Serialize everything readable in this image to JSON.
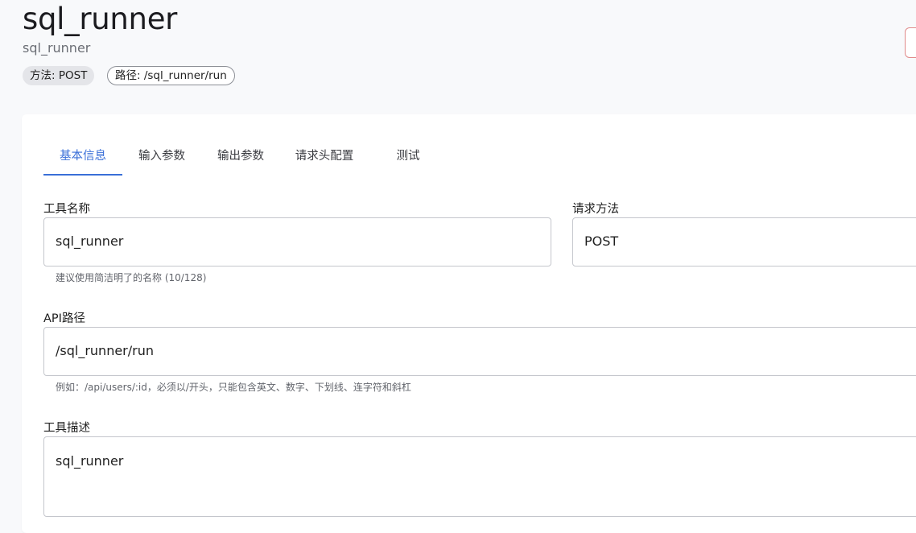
{
  "header": {
    "title": "sql_runner",
    "subtitle": "sql_runner",
    "method_chip": "方法: POST",
    "path_chip": "路径: /sql_runner/run"
  },
  "tabs": [
    {
      "label": "基本信息",
      "active": true
    },
    {
      "label": "输入参数",
      "active": false
    },
    {
      "label": "输出参数",
      "active": false
    },
    {
      "label": "请求头配置",
      "active": false
    },
    {
      "label": "测试",
      "active": false
    }
  ],
  "form": {
    "tool_name": {
      "label": "工具名称",
      "value": "sql_runner",
      "hint": "建议使用简洁明了的名称 (10/128)"
    },
    "method": {
      "label": "请求方法",
      "value": "POST"
    },
    "api_path": {
      "label": "API路径",
      "value": "/sql_runner/run",
      "hint": "例如：/api/users/:id，必须以/开头，只能包含英文、数字、下划线、连字符和斜杠"
    },
    "description": {
      "label": "工具描述",
      "value": "sql_runner"
    }
  },
  "colors": {
    "accent": "#3a6fd8",
    "danger_outline": "#e08a8a",
    "background": "#f8f9fb"
  }
}
